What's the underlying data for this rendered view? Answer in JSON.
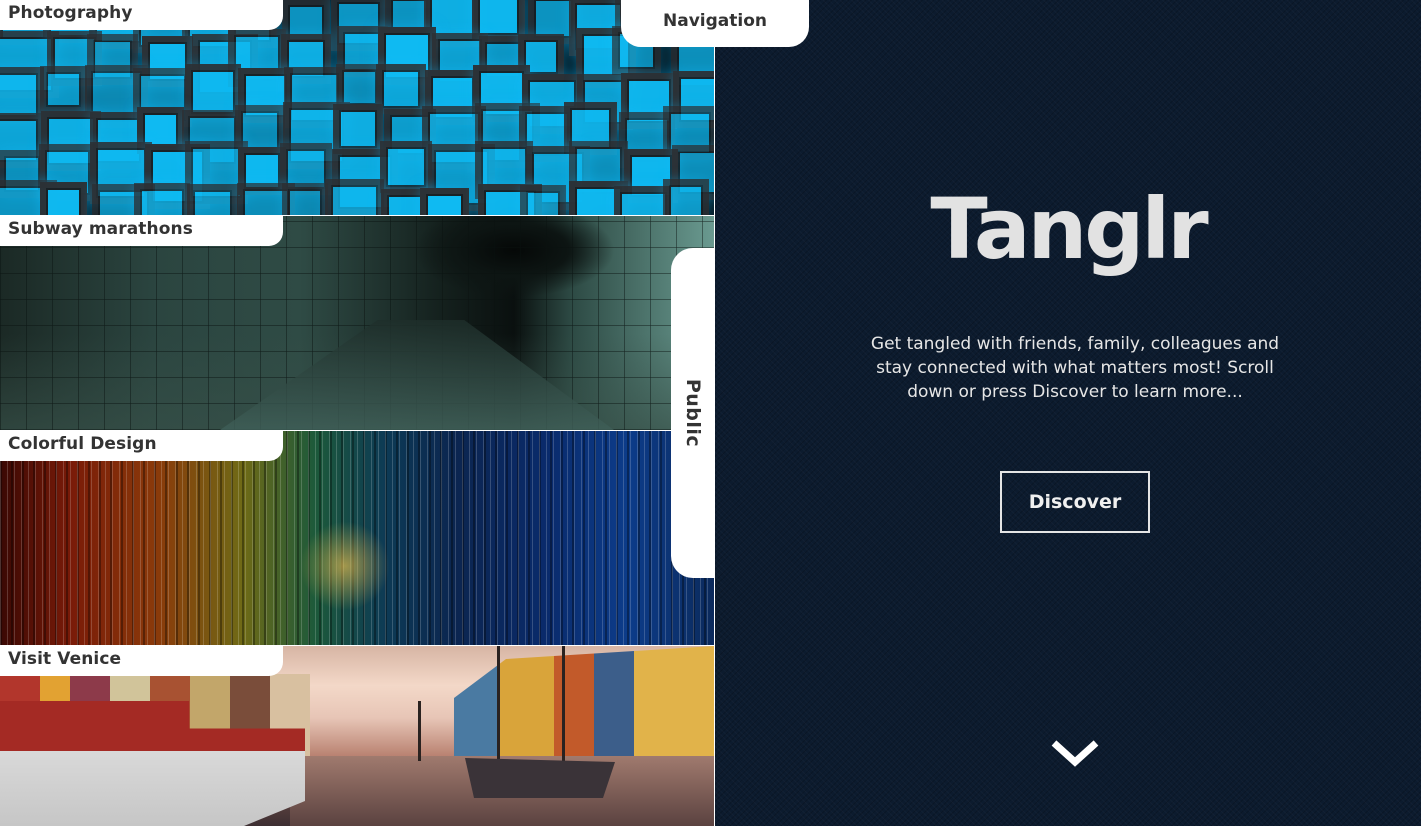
{
  "navigation": {
    "label": "Navigation"
  },
  "public_tab": {
    "label": "Public"
  },
  "gallery": {
    "cards": [
      {
        "label": "Photography",
        "image": "glowing-blue-cubes"
      },
      {
        "label": "Subway marathons",
        "image": "crumbling-tiled-subway-tunnel"
      },
      {
        "label": "Colorful Design",
        "image": "colorful-vertical-light-streaks"
      },
      {
        "label": "Visit Venice",
        "image": "harbor-canal-with-boats"
      }
    ]
  },
  "hero": {
    "brand": "Tanglr",
    "tagline": "Get tangled with friends, family, colleagues and stay connected with what matters most! Scroll down or press Discover to learn more...",
    "discover_label": "Discover",
    "scroll_icon": "chevron-down-icon"
  },
  "colors": {
    "hero_background": "#0c1b2e",
    "text_light": "#e6e6e6",
    "tab_background": "#ffffff",
    "tab_text": "#333333"
  }
}
